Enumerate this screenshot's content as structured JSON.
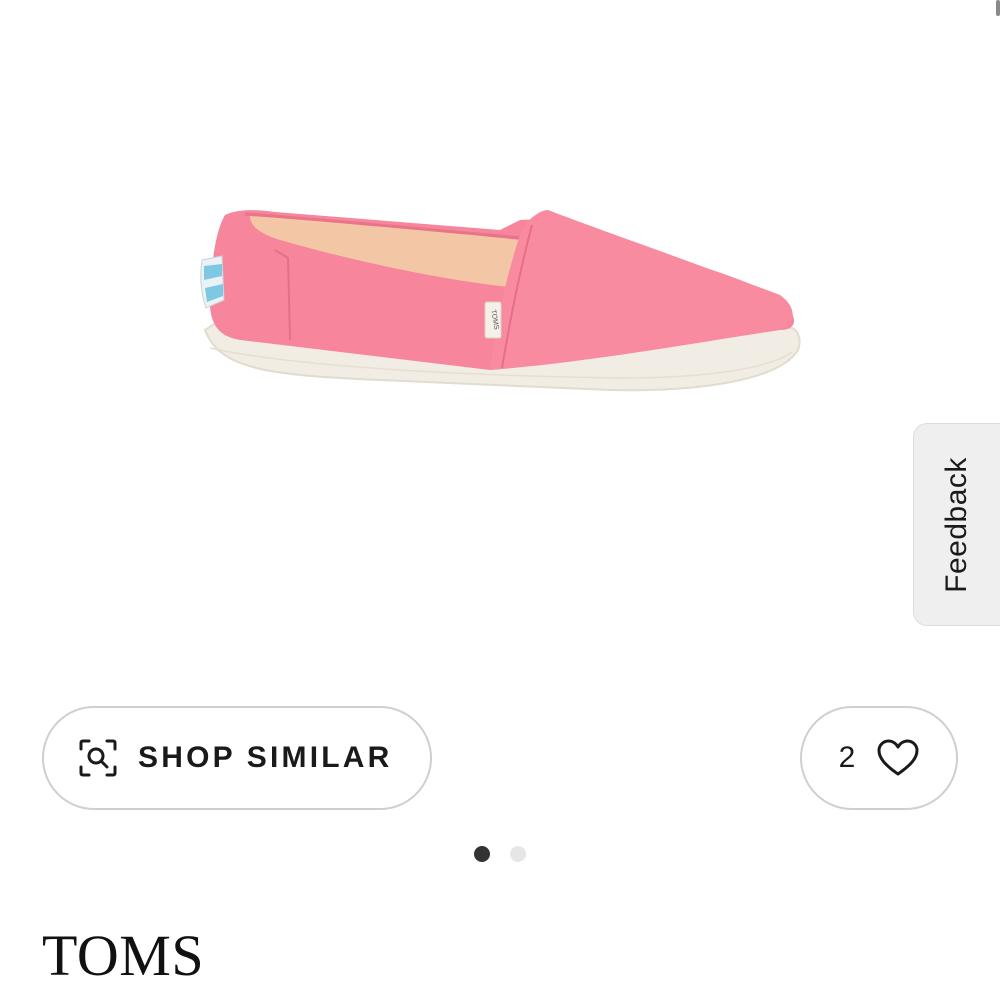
{
  "product": {
    "image_name": "pink-canvas-slip-on-shoe",
    "brand": "TOMS",
    "tag_text": "TOMS"
  },
  "feedback": {
    "label": "Feedback"
  },
  "actions": {
    "shop_similar_label": "SHOP SIMILAR",
    "shop_similar_icon": "visual-search-icon",
    "favorite_count": "2",
    "favorite_icon": "heart-outline-icon"
  },
  "carousel": {
    "total": 2,
    "current": 1
  },
  "colors": {
    "shoe_pink": "#f7869c",
    "sole": "#f1ede4",
    "border": "#cfcfcf",
    "dot_active": "#333333",
    "dot_inactive": "#e6e6e6"
  }
}
